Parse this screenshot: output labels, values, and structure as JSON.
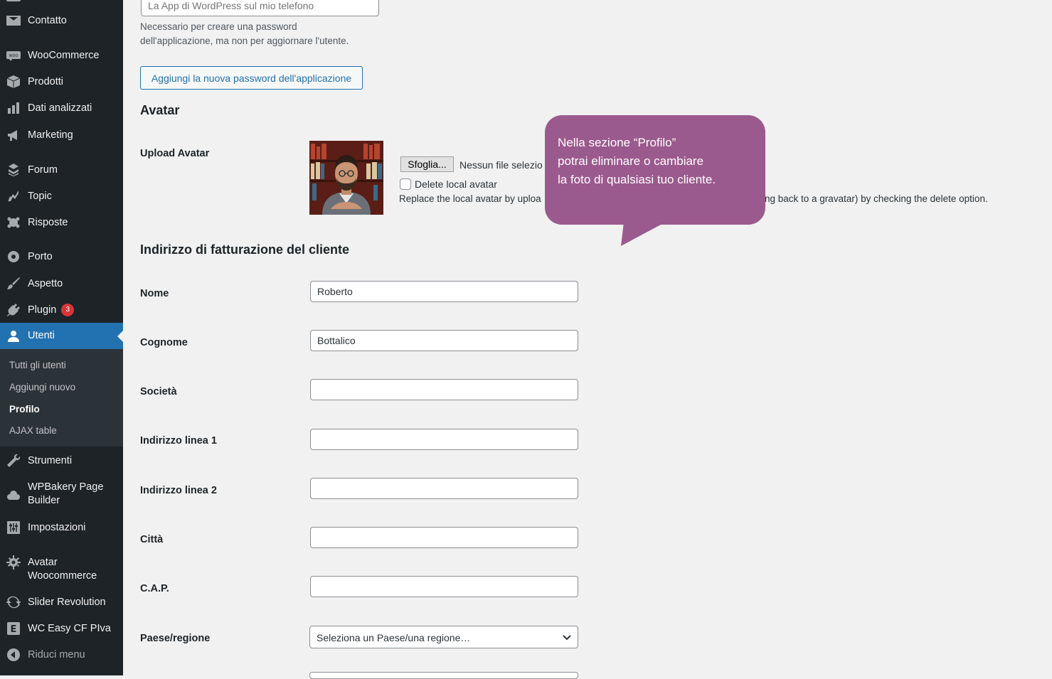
{
  "sidebar": {
    "items": [
      {
        "label": "Contatto",
        "icon": "envelope-icon"
      },
      {
        "label": "WooCommerce",
        "icon": "woocommerce-icon"
      },
      {
        "label": "Prodotti",
        "icon": "box-icon"
      },
      {
        "label": "Dati analizzati",
        "icon": "bar-chart-icon"
      },
      {
        "label": "Marketing",
        "icon": "megaphone-icon"
      },
      {
        "label": "Forum",
        "icon": "forum-icon"
      },
      {
        "label": "Topic",
        "icon": "topic-icon"
      },
      {
        "label": "Risposte",
        "icon": "replies-icon"
      },
      {
        "label": "Porto",
        "icon": "porto-icon"
      },
      {
        "label": "Aspetto",
        "icon": "brush-icon"
      },
      {
        "label": "Plugin",
        "icon": "plugin-icon",
        "badge": "3"
      },
      {
        "label": "Utenti",
        "icon": "user-icon",
        "active": true
      },
      {
        "label": "Strumenti",
        "icon": "wrench-icon"
      },
      {
        "label": "WPBakery Page Builder",
        "icon": "cloud-icon"
      },
      {
        "label": "Impostazioni",
        "icon": "settings-sliders-icon"
      },
      {
        "label": "Avatar Woocommerce",
        "icon": "gear-icon"
      },
      {
        "label": "Slider Revolution",
        "icon": "refresh-icon"
      },
      {
        "label": "WC Easy CF PIva",
        "icon": "e-logo-icon"
      },
      {
        "label": "Riduci menu",
        "icon": "collapse-icon"
      }
    ],
    "submenu": [
      {
        "label": "Tutti gli utenti"
      },
      {
        "label": "Aggiungi nuovo"
      },
      {
        "label": "Profilo",
        "current": true
      },
      {
        "label": "AJAX table"
      }
    ]
  },
  "app_password": {
    "placeholder": "La App di WordPress sul mio telefono",
    "description_line1": "Necessario per creare una password",
    "description_line2": "dell'applicazione, ma non per aggiornare l'utente.",
    "add_button": "Aggiungi la nuova password dell'applicazione"
  },
  "avatar": {
    "heading": "Avatar",
    "upload_label": "Upload Avatar",
    "browse_button": "Sfoglia...",
    "no_file": "Nessun file selezio",
    "delete_label": "Delete local avatar",
    "help_left": "Replace the local avatar by uploa",
    "help_right": "ng back to a gravatar) by checking the delete option."
  },
  "tooltip": {
    "line1": "Nella sezione “Profilo”",
    "line2": "potrai eliminare o cambiare",
    "line3": "la foto di qualsiasi tuo cliente."
  },
  "billing": {
    "heading": "Indirizzo di fatturazione del cliente",
    "fields": [
      {
        "label": "Nome",
        "value": "Roberto"
      },
      {
        "label": "Cognome",
        "value": "Bottalico"
      },
      {
        "label": "Società",
        "value": ""
      },
      {
        "label": "Indirizzo linea 1",
        "value": ""
      },
      {
        "label": "Indirizzo linea 2",
        "value": ""
      },
      {
        "label": "Città",
        "value": ""
      },
      {
        "label": "C.A.P.",
        "value": ""
      }
    ],
    "country_label": "Paese/regione",
    "country_value": "Seleziona un Paese/una regione…"
  },
  "colors": {
    "sidebar_bg": "#1d2327",
    "active_item": "#2271b1",
    "tooltip_bg": "#9b5a8e",
    "badge": "#d63638"
  }
}
